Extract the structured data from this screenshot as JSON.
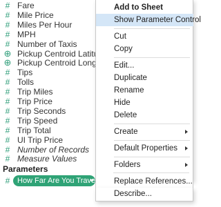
{
  "fields": [
    {
      "label": "Fare",
      "icon": "measure-icon",
      "glyph": "#"
    },
    {
      "label": "Mile Price",
      "icon": "measure-icon",
      "glyph": "#"
    },
    {
      "label": "Miles Per Hour",
      "icon": "measure-icon",
      "glyph": "#"
    },
    {
      "label": "MPH",
      "icon": "measure-icon",
      "glyph": "#"
    },
    {
      "label": "Number of Taxis",
      "icon": "measure-icon",
      "glyph": "#"
    },
    {
      "label": "Pickup Centroid Latitude",
      "icon": "globe-icon",
      "glyph": "⊕"
    },
    {
      "label": "Pickup Centroid Longitude",
      "icon": "globe-icon",
      "glyph": "⊕"
    },
    {
      "label": "Tips",
      "icon": "measure-icon",
      "glyph": "#"
    },
    {
      "label": "Tolls",
      "icon": "measure-icon",
      "glyph": "#"
    },
    {
      "label": "Trip Miles",
      "icon": "measure-icon",
      "glyph": "#"
    },
    {
      "label": "Trip Price",
      "icon": "measure-icon",
      "glyph": "#"
    },
    {
      "label": "Trip Seconds",
      "icon": "measure-icon",
      "glyph": "#"
    },
    {
      "label": "Trip Speed",
      "icon": "measure-icon",
      "glyph": "#"
    },
    {
      "label": "Trip Total",
      "icon": "measure-icon",
      "glyph": "#"
    },
    {
      "label": "UI Trip Price",
      "icon": "measure-icon",
      "glyph": "#"
    },
    {
      "label": "Number of Records",
      "icon": "measure-icon",
      "glyph": "#",
      "italic": true
    },
    {
      "label": "Measure Values",
      "icon": "measure-icon",
      "glyph": "#",
      "italic": true
    }
  ],
  "parameters": {
    "heading": "Parameters",
    "item": {
      "label": "How Far Are You Travel...",
      "icon": "measure-icon",
      "glyph": "#"
    }
  },
  "menu": {
    "add_to_sheet": "Add to Sheet",
    "show_parameter_control": "Show Parameter Control",
    "cut": "Cut",
    "copy": "Copy",
    "edit": "Edit...",
    "duplicate": "Duplicate",
    "rename": "Rename",
    "hide": "Hide",
    "delete": "Delete",
    "create": "Create",
    "default_properties": "Default Properties",
    "folders": "Folders",
    "replace_references": "Replace References...",
    "describe": "Describe..."
  },
  "colors": {
    "measure_green": "#2f9e7a",
    "pill_green": "#2fa376",
    "menu_highlight": "#d4e6f7"
  }
}
